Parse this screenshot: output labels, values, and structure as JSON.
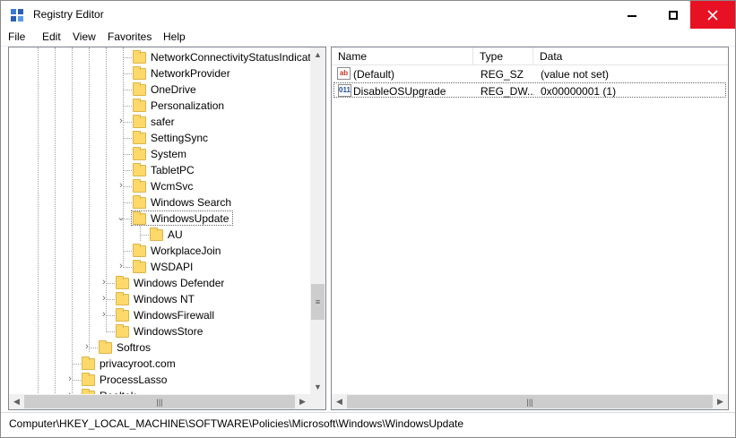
{
  "window": {
    "title": "Registry Editor",
    "icon": "registry-icon",
    "controls": {
      "minimize": "minimize-icon",
      "maximize": "maximize-icon",
      "close": "close-icon"
    }
  },
  "menu": [
    "File",
    "Edit",
    "View",
    "Favorites",
    "Help"
  ],
  "tree": {
    "items": [
      {
        "label": "NetworkConnectivityStatusIndicat",
        "expander": ""
      },
      {
        "label": "NetworkProvider",
        "expander": ""
      },
      {
        "label": "OneDrive",
        "expander": ""
      },
      {
        "label": "Personalization",
        "expander": ""
      },
      {
        "label": "safer",
        "expander": "collapsed"
      },
      {
        "label": "SettingSync",
        "expander": ""
      },
      {
        "label": "System",
        "expander": ""
      },
      {
        "label": "TabletPC",
        "expander": ""
      },
      {
        "label": "WcmSvc",
        "expander": "collapsed"
      },
      {
        "label": "Windows Search",
        "expander": ""
      },
      {
        "label": "WindowsUpdate",
        "expander": "expanded",
        "selected": true
      },
      {
        "label": "AU",
        "expander": ""
      },
      {
        "label": "WorkplaceJoin",
        "expander": ""
      },
      {
        "label": "WSDAPI",
        "expander": "collapsed"
      },
      {
        "label": "Windows Defender",
        "expander": "collapsed"
      },
      {
        "label": "Windows NT",
        "expander": "collapsed"
      },
      {
        "label": "WindowsFirewall",
        "expander": "collapsed"
      },
      {
        "label": "WindowsStore",
        "expander": ""
      },
      {
        "label": "Softros",
        "expander": "collapsed"
      },
      {
        "label": "privacyroot.com",
        "expander": ""
      },
      {
        "label": "ProcessLasso",
        "expander": "collapsed"
      },
      {
        "label": "Realtek",
        "expander": "collapsed"
      }
    ]
  },
  "list": {
    "columns": [
      "Name",
      "Type",
      "Data"
    ],
    "rows": [
      {
        "name": "(Default)",
        "type": "REG_SZ",
        "data": "(value not set)",
        "icon": "string-value-icon",
        "icon_text": "ab"
      },
      {
        "name": "DisableOSUpgrade",
        "type": "REG_DW...",
        "data": "0x00000001 (1)",
        "icon": "dword-value-icon",
        "icon_text": "011",
        "selected": true
      }
    ]
  },
  "status": {
    "path": "Computer\\HKEY_LOCAL_MACHINE\\SOFTWARE\\Policies\\Microsoft\\Windows\\WindowsUpdate"
  },
  "colors": {
    "close_button": "#e81123",
    "folder": "#fdd96b",
    "scrollbar": "#f0f0f0"
  }
}
